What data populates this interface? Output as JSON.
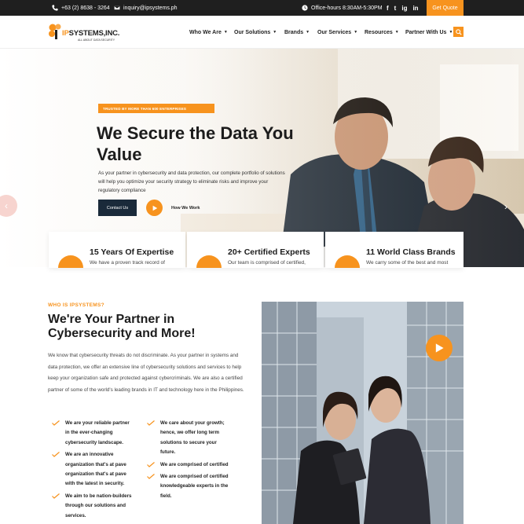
{
  "topbar": {
    "phone": "+63 (2) 8638 - 3264",
    "email": "inquiry@ipsystems.ph",
    "hours": "Office-hours 8:30AM-5:30PM",
    "socials": [
      "f",
      "t",
      "ig",
      "in"
    ],
    "quote_button": "Get Quote"
  },
  "header": {
    "logo_name_accent": "IP",
    "logo_name_rest": "SYSTEMS,INC.",
    "logo_tagline": "ALL ABOUT DATA SECURITY",
    "nav": [
      {
        "label": "Who We Are"
      },
      {
        "label": "Our Solutions"
      },
      {
        "label": "Brands"
      },
      {
        "label": "Our Services"
      },
      {
        "label": "Resources"
      },
      {
        "label": "Partner With Us"
      }
    ]
  },
  "hero": {
    "badge": "TRUSTED BY MORE THAN 600 ENTERPRISES",
    "title": "We Secure the Data You Value",
    "text": "As your partner in cybersecurity and data protection, our complete portfolio of solutions will help you optimize your security strategy to eliminate risks and improve your regulatory compliance",
    "contact_button": "Contact Us",
    "how_label": "How We Work"
  },
  "features": [
    {
      "title": "15 Years Of Expertise",
      "text": "We have a proven track record of"
    },
    {
      "title": "20+ Certified Experts",
      "text": "Our team is comprised of certified,"
    },
    {
      "title": "11 World Class Brands",
      "text": "We carry some of the best and most"
    }
  ],
  "about": {
    "eyebrow": "WHO IS IPSYSTEMS?",
    "title": "We're Your Partner in Cybersecurity and More!",
    "text": "We know that cybersecurity threats do not discriminate. As your partner in systems and data protection, we offer an extensive line of cybersecurity solutions and services to help keep your organization safe and protected against cybercriminals. We are also a certified partner of some of the world's leading brands in IT and technology here in the Philippines.",
    "bullets_left": [
      "We are your reliable partner in the ever-changing cybersecurity landscape.",
      "We are an innovative organization that's at pave organization that's at pave with the latest in security.",
      "We aim to be nation-builders through our solutions and services."
    ],
    "bullets_right": [
      "We care about your growth; hence, we offer long term solutions to secure your future.",
      "We are comprised of certified",
      "We are comprised of certified knowledgeable experts in the field."
    ]
  },
  "colors": {
    "accent": "#f7931e",
    "dark": "#1f1f1f",
    "navy": "#1a2a3a"
  }
}
